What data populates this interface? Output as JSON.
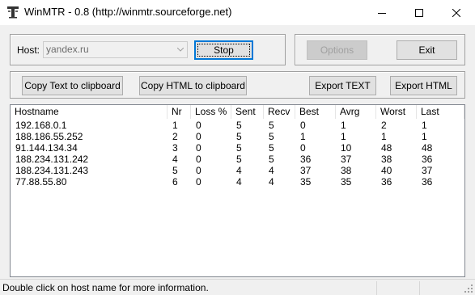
{
  "window": {
    "title": "WinMTR - 0.8 (http://winmtr.sourceforge.net)",
    "app_icon": "winmtr-icon",
    "controls": [
      "minimize-icon",
      "maximize-icon",
      "close-icon"
    ]
  },
  "host": {
    "label": "Host:",
    "value": "yandex.ru"
  },
  "buttons": {
    "stop": "Stop",
    "options": "Options",
    "exit": "Exit",
    "copy_text": "Copy Text to clipboard",
    "copy_html": "Copy HTML to clipboard",
    "export_text": "Export TEXT",
    "export_html": "Export HTML"
  },
  "table": {
    "columns": [
      "Hostname",
      "Nr",
      "Loss %",
      "Sent",
      "Recv",
      "Best",
      "Avrg",
      "Worst",
      "Last"
    ],
    "rows": [
      [
        "192.168.0.1",
        "1",
        "0",
        "5",
        "5",
        "0",
        "1",
        "2",
        "1"
      ],
      [
        "188.186.55.252",
        "2",
        "0",
        "5",
        "5",
        "1",
        "1",
        "1",
        "1"
      ],
      [
        "91.144.134.34",
        "3",
        "0",
        "5",
        "5",
        "0",
        "10",
        "48",
        "48"
      ],
      [
        "188.234.131.242",
        "4",
        "0",
        "5",
        "5",
        "36",
        "37",
        "38",
        "36"
      ],
      [
        "188.234.131.243",
        "5",
        "0",
        "4",
        "4",
        "37",
        "38",
        "40",
        "37"
      ],
      [
        "77.88.55.80",
        "6",
        "0",
        "4",
        "4",
        "35",
        "35",
        "36",
        "36"
      ]
    ]
  },
  "status": {
    "text": "Double click on host name for more information."
  },
  "colors": {
    "accent": "#0078d7",
    "window_bg": "#f0f0f0",
    "list_bg": "#ffffff",
    "disabled_text": "#a0a0a0"
  }
}
